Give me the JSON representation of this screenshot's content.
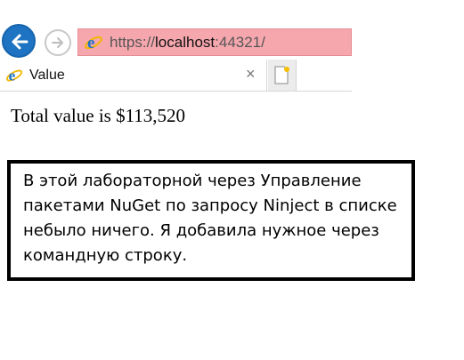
{
  "browser": {
    "url_prefix": "https://",
    "url_host": "localhost",
    "url_rest": ":44321/",
    "tab_title": "Value",
    "tab_close": "×"
  },
  "page": {
    "body_text": "Total value is $113,520"
  },
  "annotation": {
    "text": "В этой лабораторной через Управление пакетами NuGet по запросу Ninject в списке небыло ничего. Я добавила нужное через командную строку."
  },
  "colors": {
    "back_button": "#1e73c2",
    "address_bar_bg": "#f6a7ae"
  },
  "icons": [
    "back-arrow-icon",
    "forward-arrow-icon",
    "ie-icon",
    "new-tab-icon"
  ]
}
